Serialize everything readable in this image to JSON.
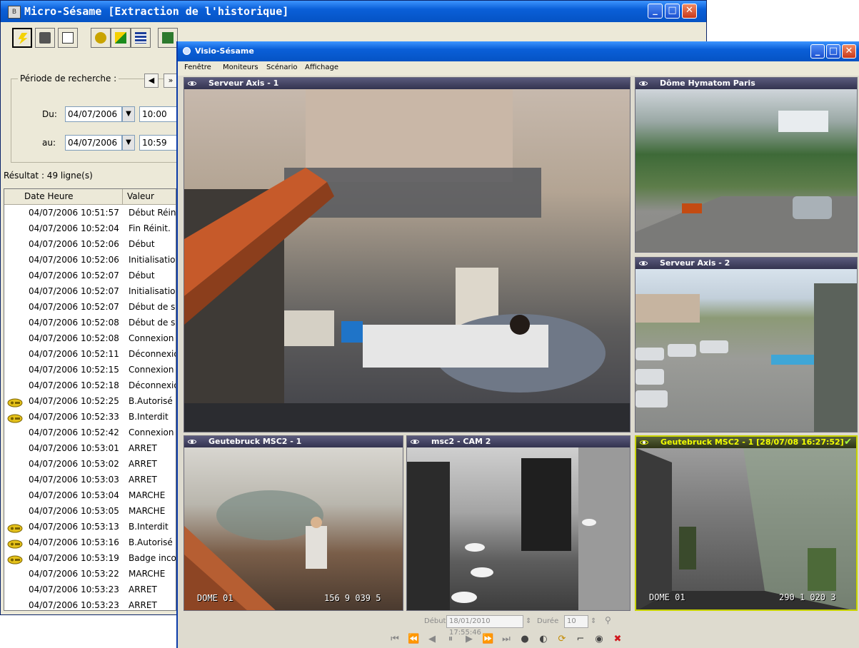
{
  "win1": {
    "title": "Micro-Sésame [Extraction de l'historique]",
    "period_legend": "Période de recherche :",
    "from_label": "Du:",
    "from_date": "04/07/2006",
    "from_time": "10:00",
    "to_label": "au:",
    "to_date": "04/07/2006",
    "to_time": "10:59",
    "result_label": "Résultat : 49 ligne(s)",
    "col_datetime": "Date Heure",
    "col_value": "Valeur",
    "rows": [
      {
        "dt": "04/07/2006 10:51:57",
        "val": "Début Réin"
      },
      {
        "dt": "04/07/2006 10:52:04",
        "val": "Fin Réinit."
      },
      {
        "dt": "04/07/2006 10:52:06",
        "val": "Début"
      },
      {
        "dt": "04/07/2006 10:52:06",
        "val": "Initialisation"
      },
      {
        "dt": "04/07/2006 10:52:07",
        "val": "Début"
      },
      {
        "dt": "04/07/2006 10:52:07",
        "val": "Initialisation"
      },
      {
        "dt": "04/07/2006 10:52:07",
        "val": "Début de s"
      },
      {
        "dt": "04/07/2006 10:52:08",
        "val": "Début de s"
      },
      {
        "dt": "04/07/2006 10:52:08",
        "val": "Connexion"
      },
      {
        "dt": "04/07/2006 10:52:11",
        "val": "Déconnexio"
      },
      {
        "dt": "04/07/2006 10:52:15",
        "val": "Connexion"
      },
      {
        "dt": "04/07/2006 10:52:18",
        "val": "Déconnexio"
      },
      {
        "dt": "04/07/2006 10:52:25",
        "val": "B.Autorisé"
      },
      {
        "dt": "04/07/2006 10:52:33",
        "val": "B.Interdit"
      },
      {
        "dt": "04/07/2006 10:52:42",
        "val": "Connexion"
      },
      {
        "dt": "04/07/2006 10:53:01",
        "val": "ARRET"
      },
      {
        "dt": "04/07/2006 10:53:02",
        "val": "ARRET"
      },
      {
        "dt": "04/07/2006 10:53:03",
        "val": "ARRET"
      },
      {
        "dt": "04/07/2006 10:53:04",
        "val": "MARCHE"
      },
      {
        "dt": "04/07/2006 10:53:05",
        "val": "MARCHE"
      },
      {
        "dt": "04/07/2006 10:53:13",
        "val": "B.Interdit"
      },
      {
        "dt": "04/07/2006 10:53:16",
        "val": "B.Autorisé"
      },
      {
        "dt": "04/07/2006 10:53:19",
        "val": "Badge inco"
      },
      {
        "dt": "04/07/2006 10:53:22",
        "val": "MARCHE"
      },
      {
        "dt": "04/07/2006 10:53:23",
        "val": "ARRET"
      },
      {
        "dt": "04/07/2006 10:53:23",
        "val": "ARRET"
      }
    ]
  },
  "win2": {
    "title": "Visio-Sésame",
    "menu": [
      "Fenêtre",
      "Moniteurs",
      "Scénario",
      "Affichage"
    ],
    "panes": {
      "p1": "Serveur Axis - 1",
      "p2": "Dôme Hymatom Paris",
      "p3": "Serveur Axis - 2",
      "p4": "Geutebruck MSC2 - 1",
      "p5": "msc2 - CAM 2",
      "p6": "Geutebruck MSC2 - 1 [28/07/08 16:27:52]"
    },
    "osd": {
      "p4_left": "DOME 01",
      "p4_right": "156 9 039 5",
      "p6_left": "DOME 01",
      "p6_right": "290 1 020 3"
    },
    "bottom": {
      "start_label": "Début",
      "start_value": "18/01/2010 17:55:46",
      "duration_label": "Durée",
      "duration_value": "10"
    }
  },
  "colors": {
    "xp_title": "#0a5fd8",
    "active_pane_title": "#f2ff00",
    "close_red": "#c8391b"
  }
}
